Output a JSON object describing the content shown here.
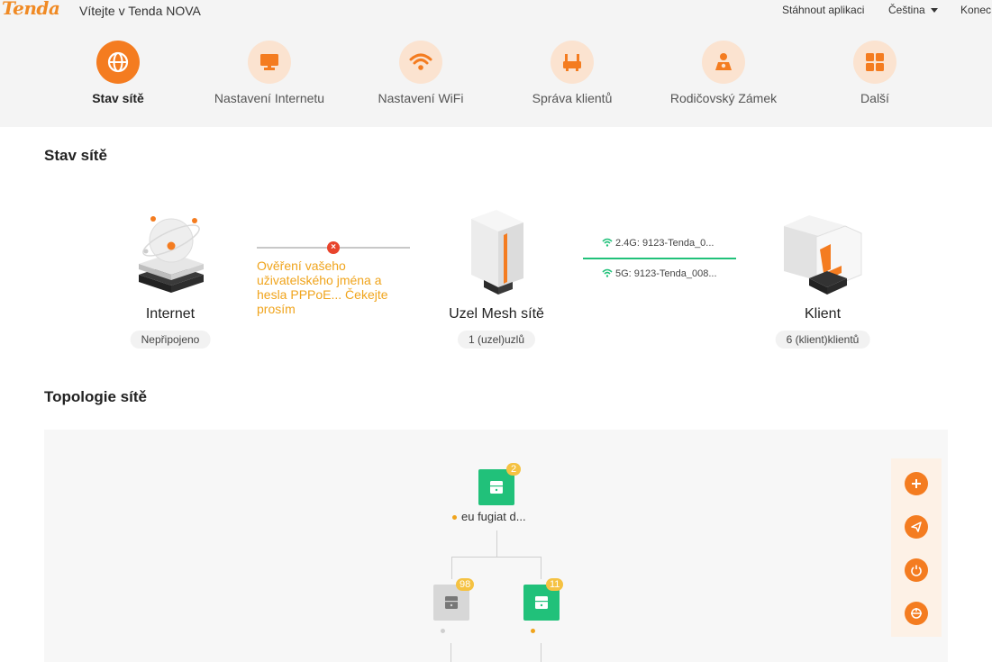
{
  "header": {
    "logo": "Tenda",
    "welcome": "Vítejte v Tenda NOVA",
    "download_app": "Stáhnout aplikaci",
    "language": "Čeština",
    "logout": "Konec"
  },
  "nav": [
    {
      "label": "Stav sítě",
      "icon": "globe-icon",
      "active": true
    },
    {
      "label": "Nastavení Internetu",
      "icon": "monitor-icon"
    },
    {
      "label": "Nastavení WiFi",
      "icon": "wifi-icon"
    },
    {
      "label": "Správa klientů",
      "icon": "router-icon"
    },
    {
      "label": "Rodičovský Zámek",
      "icon": "parent-icon"
    },
    {
      "label": "Další",
      "icon": "grid-icon"
    }
  ],
  "status": {
    "title": "Stav sítě",
    "internet": {
      "label": "Internet",
      "badge": "Nepřipojeno"
    },
    "error_message": "Ověření vašeho uživatelského jména a hesla PPPoE... Čekejte prosím",
    "mesh": {
      "label": "Uzel Mesh sítě",
      "badge": "1 (uzel)uzlů"
    },
    "wifi_24": "2.4G: 9123-Tenda_0...",
    "wifi_5": "5G: 9123-Tenda_008...",
    "client": {
      "label": "Klient",
      "badge": "6 (klient)klientů"
    }
  },
  "topology": {
    "title": "Topologie sítě",
    "root": {
      "count": "2",
      "name": "eu fugiat d..."
    },
    "children": [
      {
        "count": "98"
      },
      {
        "count": "11"
      }
    ]
  },
  "colors": {
    "accent": "#f47c20",
    "accent_light": "#fbe3d0",
    "node_green": "#21c17a",
    "error": "#e8442c",
    "warning": "#f0a41c",
    "badge_yellow": "#f5c242"
  }
}
